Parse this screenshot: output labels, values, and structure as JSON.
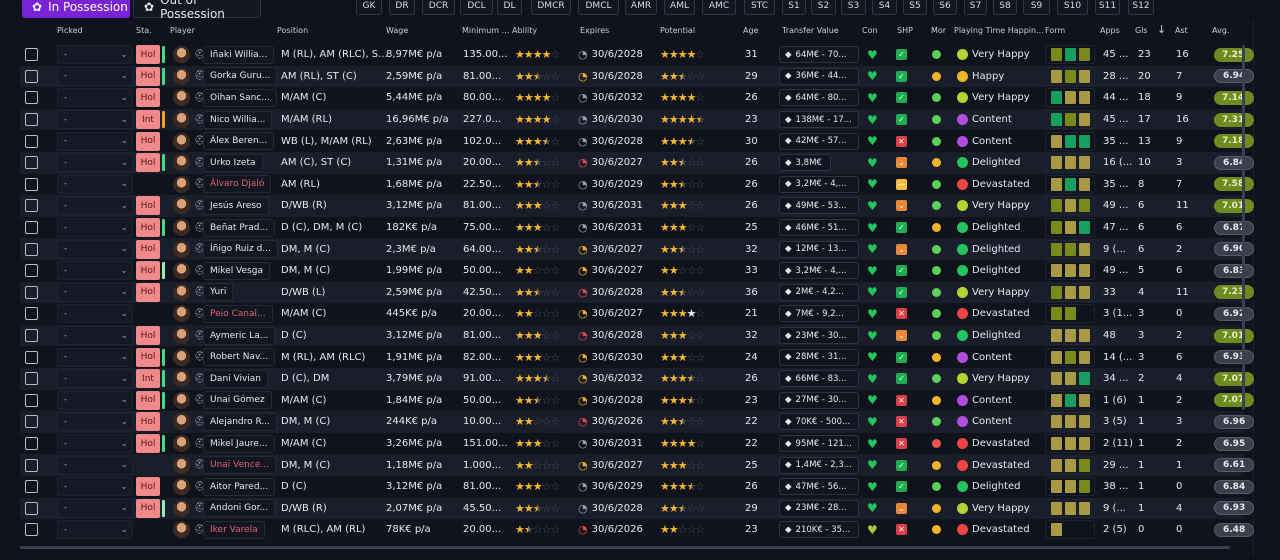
{
  "tabs": {
    "in_possession": "In Possession",
    "out_of_possession": "Out of Possession"
  },
  "positions": [
    "GK",
    "DR",
    "DCR",
    "DCL",
    "DL",
    "DMCR",
    "DMCL",
    "AMR",
    "AML",
    "AMC",
    "STC",
    "S1",
    "S2",
    "S3",
    "S4",
    "S5",
    "S6",
    "S7",
    "S8",
    "S9",
    "S10",
    "S11",
    "S12"
  ],
  "headers": {
    "picked": "Picked",
    "status": "Sta.",
    "player": "Player",
    "position": "Position",
    "wage": "Wage",
    "minimum": "Minimum ...",
    "ability": "Ability",
    "expires": "Expires",
    "potential": "Potential",
    "age": "Age",
    "transfer_value": "Transfer Value",
    "con": "Con",
    "shp": "SHP",
    "mor": "Mor",
    "pth": "Playing Time Happin...",
    "form": "Form",
    "apps": "Apps",
    "gls": "Gls",
    "ast": "Ast",
    "avg": "Avg."
  },
  "sort": {
    "column": "Gls",
    "direction": "descending"
  },
  "colors": {
    "accent": "#7a22d6",
    "star": "#f5b82e",
    "olive": "#7a8a1a",
    "green": "#15a060",
    "khaki": "#a89a45"
  },
  "rows": [
    {
      "picked": "-",
      "status": "Hol",
      "bar": "green",
      "name": "Iñaki Willia...",
      "pos": "M (RL), AM (RLC), S...",
      "wage": "8,97M€ p/a",
      "min": "135.00...",
      "ab": 4,
      "exp": "30/6/2028",
      "ec": "grey",
      "pot": 4,
      "age": "31",
      "tv": "64M€ - 70...",
      "heart": "green",
      "shp": "ok",
      "mor": "green",
      "pth": "Very Happy",
      "form": "ogo",
      "apps": "45 ...",
      "gls": "23",
      "ast": "16",
      "avg": "7.25"
    },
    {
      "picked": "-",
      "status": "Hol",
      "bar": "green",
      "name": "Gorka Guru...",
      "pos": "AM (RL), ST (C)",
      "wage": "2,59M€ p/a",
      "min": "81.00...",
      "ab": 2.5,
      "exp": "30/6/2028",
      "ec": "yellow",
      "pot": 2.5,
      "age": "29",
      "tv": "36M€ - 44...",
      "heart": "green",
      "shp": "ok",
      "mor": "yellow",
      "pth": "Happy",
      "form": "kok",
      "apps": "28 ...",
      "gls": "20",
      "ast": "7",
      "avg": "6.94"
    },
    {
      "picked": "-",
      "status": "Hol",
      "bar": "",
      "name": "Oihan Sanc...",
      "pos": "M/AM (C)",
      "wage": "5,44M€ p/a",
      "min": "80.00...",
      "ab": 4,
      "exp": "30/6/2032",
      "ec": "grey",
      "pot": 4,
      "age": "26",
      "tv": "64M€ - 80...",
      "heart": "green",
      "shp": "ok",
      "mor": "green",
      "pth": "Very Happy",
      "form": "gkk",
      "apps": "44 ...",
      "gls": "18",
      "ast": "9",
      "avg": "7.14"
    },
    {
      "picked": "-",
      "status": "Int",
      "bar": "orange",
      "name": "Nico Willia...",
      "pos": "M/AM (RL)",
      "wage": "16,96M€ p/a",
      "min": "227.0...",
      "ab": 4,
      "exp": "30/6/2030",
      "ec": "grey",
      "pot": 4.5,
      "age": "23",
      "tv": "138M€ - 17...",
      "heart": "green",
      "shp": "ok",
      "mor": "green",
      "pth": "Content",
      "form": "gok",
      "apps": "45 ...",
      "gls": "17",
      "ast": "16",
      "avg": "7.31"
    },
    {
      "picked": "-",
      "status": "Hol",
      "bar": "",
      "name": "Álex Beren...",
      "pos": "WB (L), M/AM (RL)",
      "wage": "2,63M€ p/a",
      "min": "102.0...",
      "ab": 3.5,
      "exp": "30/6/2028",
      "ec": "grey",
      "pot": 3.5,
      "age": "30",
      "tv": "42M€ - 57...",
      "heart": "green",
      "shp": "x",
      "mor": "green",
      "pth": "Content",
      "form": "kgg",
      "apps": "35 ...",
      "gls": "13",
      "ast": "9",
      "avg": "7.18"
    },
    {
      "picked": "-",
      "status": "Hol",
      "bar": "green",
      "name": "Urko Izeta",
      "pos": "AM (C), ST (C)",
      "wage": "1,31M€ p/a",
      "min": "20.00...",
      "ab": 2.5,
      "exp": "30/6/2027",
      "ec": "red",
      "pot": 2.5,
      "age": "26",
      "tv": "3,8M€",
      "heart": "green",
      "shp": "warn",
      "mor": "yellow",
      "pth": "Delighted",
      "form": "kkk",
      "apps": "16 (...",
      "gls": "10",
      "ast": "3",
      "avg": "6.84"
    },
    {
      "picked": "-",
      "status": "",
      "bar": "",
      "name": "Álvaro Djaló",
      "loan": true,
      "pos": "AM (RL)",
      "wage": "1,68M€ p/a",
      "min": "22.50...",
      "ab": 2.5,
      "exp": "30/6/2029",
      "ec": "grey",
      "pot": 2.5,
      "age": "26",
      "tv": "3,2M€ - 4,...",
      "heart": "green",
      "shp": "minus",
      "mor": "green",
      "pth": "Devastated",
      "form": "kgk",
      "apps": "35 ...",
      "gls": "8",
      "ast": "7",
      "avg": "7.58"
    },
    {
      "picked": "-",
      "status": "Hol",
      "bar": "",
      "name": "Jesús Areso",
      "pos": "D/WB (R)",
      "wage": "3,12M€ p/a",
      "min": "81.00...",
      "ab": 3,
      "exp": "30/6/2031",
      "ec": "grey",
      "pot": 3,
      "age": "26",
      "tv": "49M€ - 53...",
      "heart": "green",
      "shp": "warn",
      "mor": "green",
      "pth": "Very Happy",
      "form": "oko",
      "apps": "49 ...",
      "gls": "6",
      "ast": "11",
      "avg": "7.01"
    },
    {
      "picked": "-",
      "status": "Hol",
      "bar": "green",
      "name": "Beñat Prad...",
      "pos": "D (C), DM, M (C)",
      "wage": "182K€ p/a",
      "min": "75.00...",
      "ab": 3,
      "exp": "30/6/2031",
      "ec": "grey",
      "pot": 3,
      "age": "25",
      "tv": "46M€ - 51...",
      "heart": "green",
      "shp": "ok",
      "mor": "yellow",
      "pth": "Delighted",
      "form": "okg",
      "apps": "47 ...",
      "gls": "6",
      "ast": "6",
      "avg": "6.87"
    },
    {
      "picked": "-",
      "status": "Hol",
      "bar": "",
      "name": "Íñigo Ruiz d...",
      "pos": "DM, M (C)",
      "wage": "2,3M€ p/a",
      "min": "64.00...",
      "ab": 2.5,
      "exp": "30/6/2027",
      "ec": "yellow",
      "pot": 2.5,
      "age": "32",
      "tv": "12M€ - 13...",
      "heart": "green",
      "shp": "warn",
      "mor": "green",
      "pth": "Delighted",
      "form": "ook",
      "apps": "9 (...",
      "gls": "6",
      "ast": "2",
      "avg": "6.90"
    },
    {
      "picked": "-",
      "status": "Hol",
      "bar": "light",
      "name": "Mikel Vesga",
      "pos": "DM, M (C)",
      "wage": "1,99M€ p/a",
      "min": "50.00...",
      "ab": 2,
      "exp": "30/6/2027",
      "ec": "yellow",
      "pot": 2,
      "age": "33",
      "tv": "3,2M€ - 4,...",
      "heart": "green",
      "shp": "ok",
      "mor": "green",
      "pth": "Delighted",
      "form": "kkk",
      "apps": "49 ...",
      "gls": "5",
      "ast": "6",
      "avg": "6.83"
    },
    {
      "picked": "-",
      "status": "Hol",
      "bar": "",
      "name": "Yuri",
      "pos": "D/WB (L)",
      "wage": "2,59M€ p/a",
      "min": "42.50...",
      "ab": 2.5,
      "exp": "30/6/2028",
      "ec": "red",
      "pot": 2.5,
      "age": "36",
      "tv": "2M€ - 4,2...",
      "heart": "green",
      "shp": "ok",
      "mor": "green",
      "pth": "Very Happy",
      "form": "okk",
      "apps": "33",
      "gls": "4",
      "ast": "11",
      "avg": "7.23"
    },
    {
      "picked": "-",
      "status": "",
      "bar": "",
      "name": "Peio Canal...",
      "loan": true,
      "pos": "M/AM (C)",
      "wage": "445K€ p/a",
      "min": "20.00...",
      "ab": 2,
      "exp": "30/6/2027",
      "ec": "yellow",
      "pot": 3,
      "pot_range": 4,
      "age": "21",
      "tv": "7M€ - 9,2...",
      "heart": "green",
      "shp": "x",
      "mor": "green",
      "pth": "Devastated",
      "form": "oo",
      "apps": "3 (1...",
      "gls": "3",
      "ast": "0",
      "avg": "6.92"
    },
    {
      "picked": "-",
      "status": "Hol",
      "bar": "",
      "name": "Aymeric La...",
      "pos": "D (C)",
      "wage": "3,12M€ p/a",
      "min": "81.00...",
      "ab": 3,
      "exp": "30/6/2028",
      "ec": "red",
      "pot": 3,
      "age": "32",
      "tv": "23M€ - 30...",
      "heart": "green",
      "shp": "warn",
      "mor": "green",
      "pth": "Delighted",
      "form": "kkk",
      "apps": "48",
      "gls": "3",
      "ast": "2",
      "avg": "7.01"
    },
    {
      "picked": "-",
      "status": "Hol",
      "bar": "green",
      "name": "Robert Nav...",
      "pos": "M (RL), AM (RLC)",
      "wage": "1,91M€ p/a",
      "min": "82.00...",
      "ab": 3,
      "exp": "30/6/2030",
      "ec": "yellow",
      "pot": 3,
      "age": "24",
      "tv": "28M€ - 31...",
      "heart": "green",
      "shp": "ok",
      "mor": "yellow",
      "pth": "Content",
      "form": "kok",
      "apps": "14 (...",
      "gls": "3",
      "ast": "6",
      "avg": "6.93"
    },
    {
      "picked": "-",
      "status": "Int",
      "bar": "green",
      "name": "Dani Vivian",
      "pos": "D (C), DM",
      "wage": "3,79M€ p/a",
      "min": "91.00...",
      "ab": 3.5,
      "exp": "30/6/2032",
      "ec": "yellow",
      "pot": 3.5,
      "age": "26",
      "tv": "66M€ - 83...",
      "heart": "green",
      "shp": "ok",
      "mor": "green",
      "pth": "Very Happy",
      "form": "kkg",
      "apps": "34 ...",
      "gls": "2",
      "ast": "4",
      "avg": "7.07"
    },
    {
      "picked": "-",
      "status": "Hol",
      "bar": "green",
      "name": "Unai Gómez",
      "pos": "M/AM (C)",
      "wage": "1,84M€ p/a",
      "min": "50.00...",
      "ab": 2.5,
      "exp": "30/6/2028",
      "ec": "yellow",
      "pot": 3.5,
      "age": "23",
      "tv": "27M€ - 30...",
      "heart": "green",
      "shp": "x",
      "mor": "yellow",
      "pth": "Content",
      "form": "kgk",
      "apps": "1 (6)",
      "gls": "1",
      "ast": "2",
      "avg": "7.07"
    },
    {
      "picked": "-",
      "status": "Hol",
      "bar": "",
      "name": "Alejandro R...",
      "pos": "DM, M (C)",
      "wage": "244K€ p/a",
      "min": "10.00...",
      "ab": 2,
      "exp": "30/6/2026",
      "ec": "red",
      "pot": 2.5,
      "age": "22",
      "tv": "70K€ - 500...",
      "heart": "green",
      "shp": "x",
      "mor": "green",
      "pth": "Content",
      "form": "kkk",
      "apps": "3 (5)",
      "gls": "1",
      "ast": "3",
      "avg": "6.96"
    },
    {
      "picked": "-",
      "status": "Hol",
      "bar": "green",
      "name": "Mikel Jaure...",
      "pos": "M/AM (C)",
      "wage": "3,26M€ p/a",
      "min": "151.00...",
      "ab": 3,
      "exp": "30/6/2031",
      "ec": "grey",
      "pot": 4,
      "age": "22",
      "tv": "95M€ - 121...",
      "heart": "green",
      "shp": "x",
      "mor": "red",
      "pth": "Devastated",
      "form": "kkk",
      "apps": "2 (11)",
      "gls": "1",
      "ast": "2",
      "avg": "6.95"
    },
    {
      "picked": "-",
      "status": "",
      "bar": "",
      "name": "Unai Vence...",
      "loan": true,
      "pos": "DM, M (C)",
      "wage": "1,18M€ p/a",
      "min": "1.000...",
      "ab": 2,
      "exp": "30/6/2027",
      "ec": "yellow",
      "pot": 3,
      "age": "25",
      "tv": "1,4M€ - 2,3...",
      "heart": "green",
      "shp": "ok",
      "mor": "yellow",
      "pth": "Devastated",
      "form": "kko",
      "apps": "29 ...",
      "gls": "1",
      "ast": "1",
      "avg": "6.61"
    },
    {
      "picked": "-",
      "status": "Hol",
      "bar": "",
      "name": "Aitor Pared...",
      "pos": "D (C)",
      "wage": "3,12M€ p/a",
      "min": "81.00...",
      "ab": 3,
      "exp": "30/6/2029",
      "ec": "grey",
      "pot": 3.5,
      "age": "26",
      "tv": "47M€ - 56...",
      "heart": "green",
      "shp": "ok",
      "mor": "green",
      "pth": "Delighted",
      "form": "kko",
      "apps": "38 ...",
      "gls": "1",
      "ast": "0",
      "avg": "6.84"
    },
    {
      "picked": "-",
      "status": "Hol",
      "bar": "light",
      "name": "Andoni Gor...",
      "pos": "D/WB (R)",
      "wage": "2,07M€ p/a",
      "min": "45.50...",
      "ab": 2.5,
      "exp": "30/6/2028",
      "ec": "grey",
      "pot": 2.5,
      "age": "29",
      "tv": "23M€ - 28...",
      "heart": "green",
      "shp": "warn",
      "mor": "yellow",
      "pth": "Very Happy",
      "form": "kkk",
      "apps": "9 (...",
      "gls": "1",
      "ast": "4",
      "avg": "6.93"
    },
    {
      "picked": "-",
      "status": "",
      "bar": "",
      "name": "Iker Varela",
      "loan": true,
      "pos": "M (RLC), AM (RL)",
      "wage": "78K€ p/a",
      "min": "20.00...",
      "ab": 1.5,
      "exp": "30/6/2026",
      "ec": "red",
      "pot": 2,
      "age": "23",
      "tv": "210K€ - 35...",
      "heart": "lime",
      "shp": "x",
      "mor": "yellow",
      "pth": "Devastated",
      "form": "k",
      "apps": "2 (5)",
      "gls": "0",
      "ast": "0",
      "avg": "6.48"
    }
  ]
}
